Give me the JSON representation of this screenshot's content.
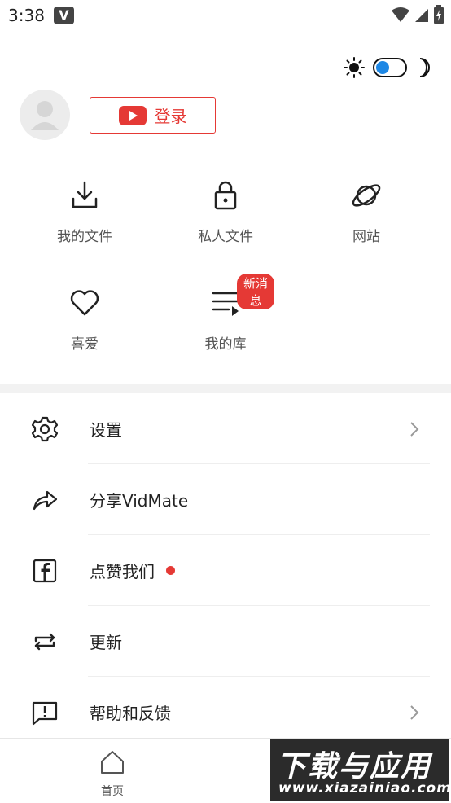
{
  "status_bar": {
    "time": "3:38",
    "app_icon_letter": "V"
  },
  "profile": {
    "login_label": "登录"
  },
  "grid": [
    {
      "label": "我的文件",
      "icon": "download-icon"
    },
    {
      "label": "私人文件",
      "icon": "lock-icon"
    },
    {
      "label": "网站",
      "icon": "planet-icon"
    },
    {
      "label": "喜爱",
      "icon": "heart-icon"
    },
    {
      "label": "我的库",
      "icon": "playlist-icon",
      "badge": "新消息"
    }
  ],
  "menu": [
    {
      "label": "设置",
      "icon": "gear-icon",
      "chevron": true
    },
    {
      "label": "分享VidMate",
      "icon": "share-icon",
      "chevron": false
    },
    {
      "label": "点赞我们",
      "icon": "facebook-icon",
      "chevron": false,
      "dot": true
    },
    {
      "label": "更新",
      "icon": "refresh-icon",
      "chevron": false
    },
    {
      "label": "帮助和反馈",
      "icon": "feedback-icon",
      "chevron": true
    }
  ],
  "bottom_nav": {
    "home_label": "首页"
  },
  "watermark": {
    "line1": "下载与应用",
    "line2": "www.xiazainiao.com"
  },
  "colors": {
    "accent_red": "#e53935",
    "toggle_blue": "#1e88e5"
  }
}
